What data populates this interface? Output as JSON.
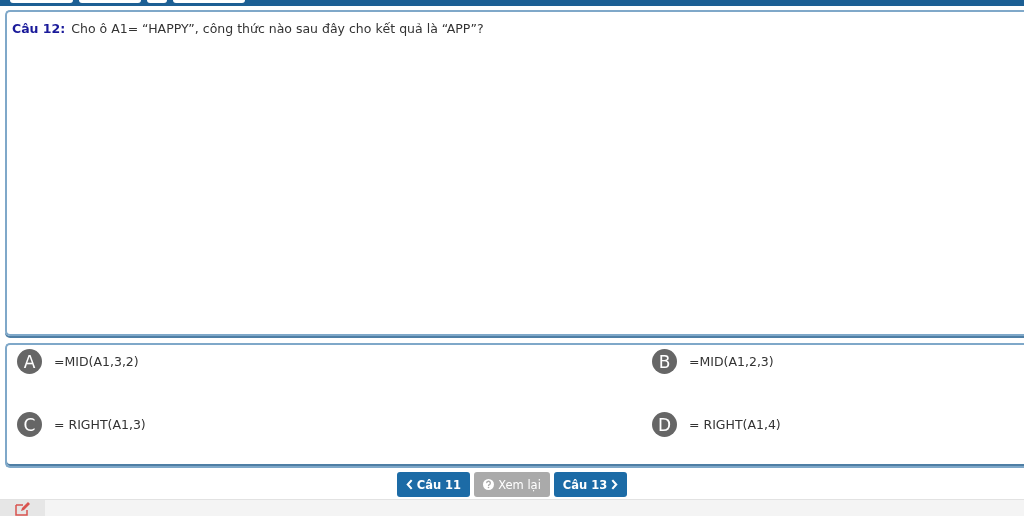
{
  "question": {
    "label": "Câu 12:",
    "text": "Cho ô A1= “HAPPY”, công thức nào sau đây cho kết quả là “APP”?"
  },
  "options": [
    {
      "letter": "A",
      "text": "=MID(A1,3,2)"
    },
    {
      "letter": "B",
      "text": "=MID(A1,2,3)"
    },
    {
      "letter": "C",
      "text": "= RIGHT(A1,3)"
    },
    {
      "letter": "D",
      "text": "= RIGHT(A1,4)"
    }
  ],
  "nav": [
    {
      "kind": "prev",
      "label": "Câu 11",
      "disabled": false
    },
    {
      "kind": "review",
      "label": "Xem lại",
      "disabled": true
    },
    {
      "kind": "next",
      "label": "Câu 13",
      "disabled": false
    }
  ]
}
